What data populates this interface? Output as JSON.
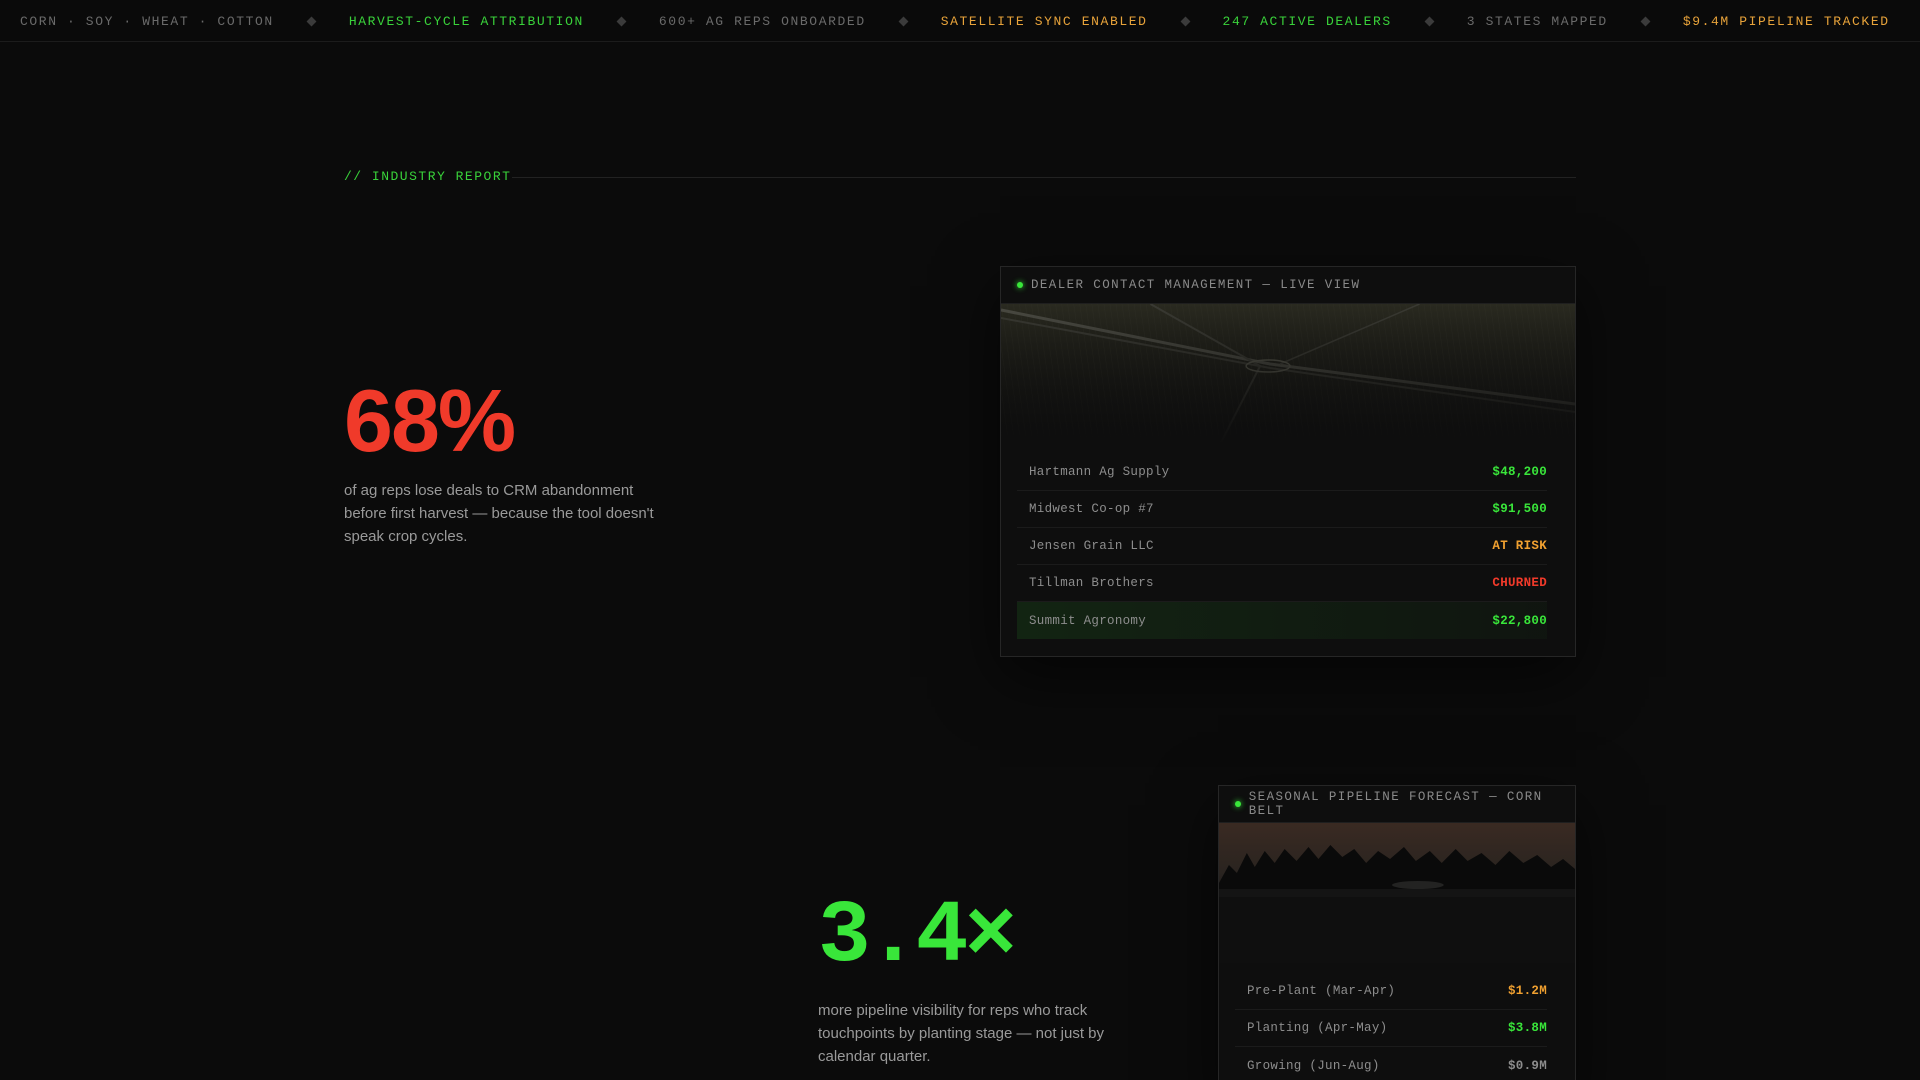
{
  "ticker": {
    "items": [
      {
        "text": "CORN · SOY · WHEAT · COTTON",
        "tone": "gray"
      },
      {
        "text": "HARVEST-CYCLE ATTRIBUTION",
        "tone": "green"
      },
      {
        "text": "600+ AG REPS ONBOARDED",
        "tone": "gray"
      },
      {
        "text": "SATELLITE SYNC ENABLED",
        "tone": "orange"
      },
      {
        "text": "247 ACTIVE DEALERS",
        "tone": "green"
      },
      {
        "text": "3 STATES MAPPED",
        "tone": "gray"
      },
      {
        "text": "$9.4M PIPELINE TRACKED",
        "tone": "orange"
      }
    ]
  },
  "section": {
    "label": "// INDUSTRY REPORT"
  },
  "stats": [
    {
      "value": "68%",
      "description": "of ag reps lose deals to CRM abandonment before first harvest — because the tool doesn't speak crop cycles."
    },
    {
      "value": "3.4×",
      "description": "more pipeline visibility for reps who track touchpoints by planting stage — not just by calendar quarter."
    }
  ],
  "cards": [
    {
      "title": "DEALER CONTACT MANAGEMENT — LIVE VIEW",
      "image": "aerial-field-image",
      "rows": [
        {
          "name": "Hartmann Ag Supply",
          "value": "$48,200",
          "tone": "green"
        },
        {
          "name": "Midwest Co-op #7",
          "value": "$91,500",
          "tone": "green"
        },
        {
          "name": "Jensen Grain LLC",
          "value": "AT RISK",
          "tone": "orange"
        },
        {
          "name": "Tillman Brothers",
          "value": "CHURNED",
          "tone": "red"
        },
        {
          "name": "Summit Agronomy",
          "value": "$22,800",
          "tone": "green",
          "highlight": true
        }
      ]
    },
    {
      "title": "SEASONAL PIPELINE FORECAST — CORN BELT",
      "image": "treeline-dusk-image",
      "rows": [
        {
          "name": "Pre-Plant (Mar-Apr)",
          "value": "$1.2M",
          "tone": "orange"
        },
        {
          "name": "Planting (Apr-May)",
          "value": "$3.8M",
          "tone": "green"
        },
        {
          "name": "Growing (Jun-Aug)",
          "value": "$0.9M",
          "tone": "gray"
        }
      ]
    }
  ],
  "colors": {
    "background": "#0b0b0b",
    "accent_green": "#39e63a",
    "accent_orange": "#f0a030",
    "accent_red": "#f03a2a"
  }
}
